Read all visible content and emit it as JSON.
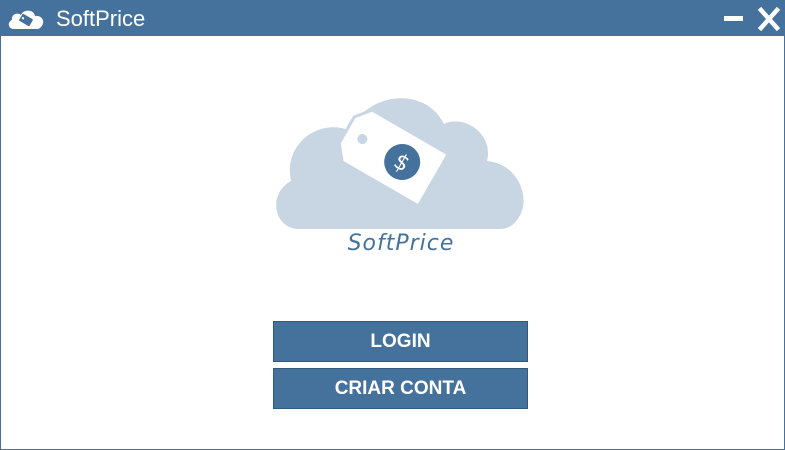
{
  "window": {
    "title": "SoftPrice",
    "app_icon": "cloud-tag-icon",
    "minimize_icon": "minimize-icon",
    "close_icon": "close-icon"
  },
  "logo": {
    "wordmark": "SoftPrice",
    "icon": "cloud-price-tag-logo",
    "tag_symbol": "$"
  },
  "actions": {
    "login_label": "LOGIN",
    "create_account_label": "CRIAR CONTA"
  },
  "colors": {
    "brand_blue": "#45729c",
    "cloud_light": "#c8d6e4",
    "background": "#ffffff"
  }
}
